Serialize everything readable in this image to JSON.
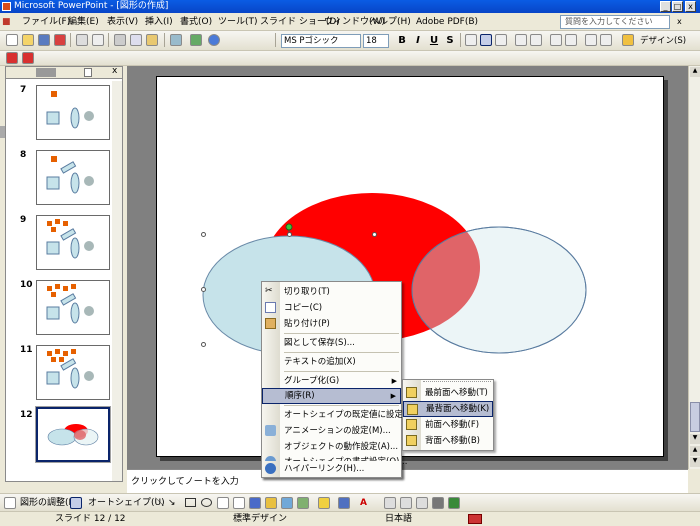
{
  "window": {
    "title": "Microsoft PowerPoint - [図形の作成]",
    "help_placeholder": "質問を入力してください",
    "close_x": "x"
  },
  "menu": [
    "ファイル(F)",
    "編集(E)",
    "表示(V)",
    "挿入(I)",
    "書式(O)",
    "ツール(T)",
    "スライド ショー(D)",
    "ウィンドウ(W)",
    "ヘルプ(H)",
    "Adobe PDF(B)"
  ],
  "format_toolbar": {
    "font": "MS Pゴシック",
    "size": "18",
    "bold": "B",
    "italic": "I",
    "underline": "U",
    "shadow": "S",
    "design": "デザイン(S)"
  },
  "slides": [
    {
      "num": "7"
    },
    {
      "num": "8"
    },
    {
      "num": "9"
    },
    {
      "num": "10"
    },
    {
      "num": "11"
    },
    {
      "num": "12"
    }
  ],
  "notes_placeholder": "クリックしてノートを入力",
  "context_menu": {
    "items": [
      {
        "label": "切り取り(T)",
        "icon": "scissors-icon"
      },
      {
        "label": "コピー(C)",
        "icon": "copy-icon"
      },
      {
        "label": "貼り付け(P)",
        "icon": "paste-icon"
      },
      {
        "label": "図として保存(S)...",
        "icon": ""
      },
      {
        "label": "テキストの追加(X)",
        "icon": ""
      },
      {
        "label": "グループ化(G)",
        "icon": ""
      },
      {
        "label": "順序(R)",
        "icon": ""
      },
      {
        "label": "オートシェイプの既定値に設定(D)",
        "icon": ""
      },
      {
        "label": "アニメーションの設定(M)...",
        "icon": "animation-icon"
      },
      {
        "label": "オブジェクトの動作設定(A)...",
        "icon": ""
      },
      {
        "label": "オートシェイプの書式設定(O)...",
        "icon": "format-shape-icon"
      },
      {
        "label": "ハイパーリンク(H)...",
        "icon": "hyperlink-icon"
      }
    ]
  },
  "submenu": {
    "items": [
      {
        "label": "最前面へ移動(T)"
      },
      {
        "label": "最背面へ移動(K)"
      },
      {
        "label": "前面へ移動(F)"
      },
      {
        "label": "背面へ移動(B)"
      }
    ]
  },
  "drawbar": {
    "draw": "図形の調整(R)",
    "autoshape": "オートシェイプ(U)"
  },
  "status": {
    "slide": "スライド 12 / 12",
    "design": "標準デザイン",
    "lang": "日本語"
  },
  "colors": {
    "red": "#ff0000",
    "lightblue": "#c6e3ea",
    "overlap": "#e06468",
    "titlebar": "#0a5ce4"
  }
}
